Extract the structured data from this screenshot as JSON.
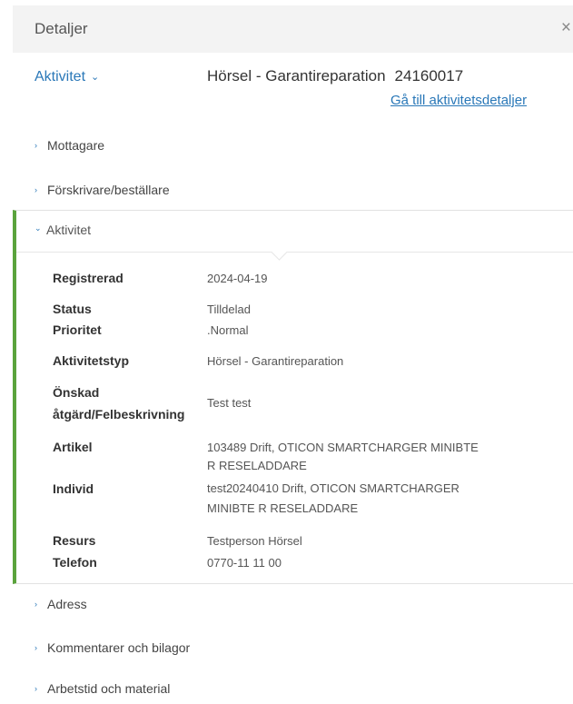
{
  "header": {
    "title": "Detaljer",
    "close_icon": "close-icon"
  },
  "activity": {
    "dropdown_label": "Aktivitet",
    "title": "Hörsel - Garantireparation",
    "number": "24160017",
    "link": "Gå till aktivitetsdetaljer"
  },
  "sections_top": [
    "Mottagare",
    "Förskrivare/beställare"
  ],
  "panel": {
    "title": "Aktivitet",
    "rows": [
      {
        "label": "Registrerad",
        "value": "2024-04-19"
      },
      {
        "label": "Status",
        "value": "Tilldelad"
      },
      {
        "label": "Prioritet",
        "value": ".Normal"
      },
      {
        "label": "Aktivitetstyp",
        "value": "Hörsel - Garantireparation"
      },
      {
        "label_line1": "Önskad",
        "label_line2": "åtgärd/Felbeskrivning",
        "value": "Test test"
      },
      {
        "label": "Artikel",
        "value_line1": "103489 Drift, OTICON SMARTCHARGER MINIBTE",
        "value_line2": "R RESELADDARE"
      },
      {
        "label": "Individ",
        "value_line1": "test20240410 Drift, OTICON SMARTCHARGER",
        "value_line2": "MINIBTE R RESELADDARE"
      },
      {
        "label": "Resurs",
        "value": "Testperson Hörsel"
      },
      {
        "label": "Telefon",
        "value": "0770-11 11 00"
      }
    ]
  },
  "sections_bottom": [
    "Adress",
    "Kommentarer och bilagor",
    "Arbetstid och material"
  ],
  "colors": {
    "accent": "#2a78b8",
    "panel_border": "#5aa33c",
    "header_bg": "#f3f3f3"
  }
}
